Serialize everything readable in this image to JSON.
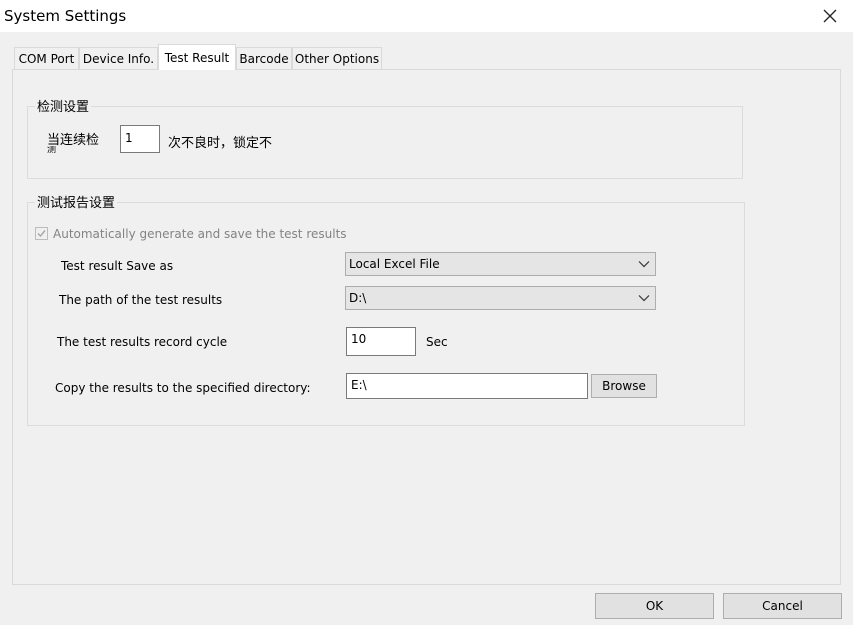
{
  "window": {
    "title": "System Settings"
  },
  "tabs": [
    {
      "label": "COM Port"
    },
    {
      "label": "Device Info."
    },
    {
      "label": "Test Result"
    },
    {
      "label": "Barcode"
    },
    {
      "label": "Other Options"
    }
  ],
  "active_tab": "Test Result",
  "detect_group": {
    "title": "检测设置",
    "prefix_line1": "当连续检",
    "prefix_line2": "测",
    "count_value": "1",
    "suffix": "次不良时，锁定不"
  },
  "report_group": {
    "title": "测试报告设置",
    "auto_generate_label": "Automatically generate and save the test results",
    "auto_generate_checked": true,
    "save_as_label": "Test result Save as",
    "save_as_value": "Local Excel File",
    "path_label": "The path of the test results",
    "path_value": "D:\\",
    "cycle_label": "The test results record cycle",
    "cycle_value": "10",
    "cycle_unit": "Sec",
    "copy_label": "Copy the results to the specified directory:",
    "copy_value": "E:\\",
    "browse_label": "Browse"
  },
  "footer": {
    "ok_label": "OK",
    "cancel_label": "Cancel"
  }
}
